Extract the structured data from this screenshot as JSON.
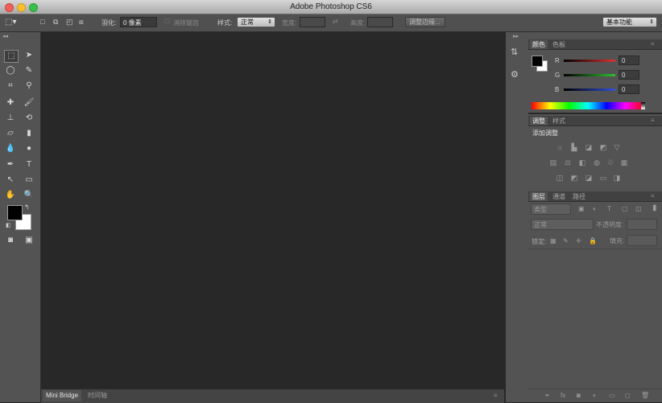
{
  "window": {
    "title": "Adobe Photoshop CS6",
    "traffic_lights": [
      "#f25f58",
      "#fbbe2e",
      "#38c149"
    ]
  },
  "options_bar": {
    "feather_label": "羽化:",
    "feather_value": "0 像素",
    "antialias_label": "消除锯齿",
    "style_label": "样式:",
    "style_value": "正常",
    "width_label": "宽度:",
    "height_label": "高度:",
    "refine_edge_button": "调整边缘...",
    "workspace_value": "基本功能"
  },
  "color_panel": {
    "tabs": [
      "颜色",
      "色板"
    ],
    "channels": [
      {
        "label": "R",
        "value": "0",
        "color": "#e03030"
      },
      {
        "label": "G",
        "value": "0",
        "color": "#30c030"
      },
      {
        "label": "B",
        "value": "0",
        "color": "#3050e0"
      }
    ]
  },
  "adjustments_panel": {
    "tabs": [
      "调整",
      "样式"
    ],
    "heading": "添加调整"
  },
  "layers_panel": {
    "tabs": [
      "图层",
      "通道",
      "路径"
    ],
    "filter_label": "类型",
    "blend_mode": "正常",
    "opacity_label": "不透明度:",
    "lock_label": "锁定:",
    "fill_label": "填充:"
  },
  "bottom_tabs": [
    "Mini Bridge",
    "时间轴"
  ],
  "colors": {
    "foreground": "#000000",
    "background": "#ffffff"
  }
}
